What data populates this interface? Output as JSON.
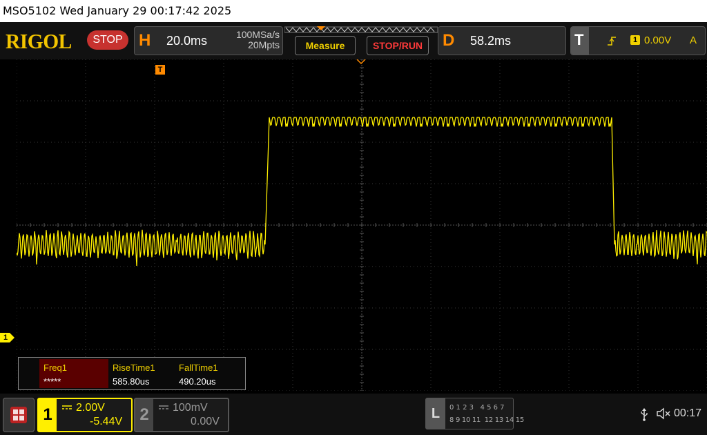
{
  "title": "MSO5102  Wed January 29 00:17:42 2025",
  "brand": "RIGOL",
  "run_state": "STOP",
  "horizontal": {
    "letter": "H",
    "timebase": "20.0ms",
    "sample_rate": "100MSa/s",
    "memory_depth": "20Mpts"
  },
  "buttons": {
    "measure": "Measure",
    "stop_run": "STOP/RUN"
  },
  "delay": {
    "letter": "D",
    "value": "58.2ms"
  },
  "trigger": {
    "letter": "T",
    "channel": "1",
    "level": "0.00V",
    "mode": "A"
  },
  "markers": {
    "trigger_position": "T",
    "ch1_ground": "1"
  },
  "measurements": [
    {
      "label": "Freq1",
      "value": "*****"
    },
    {
      "label": "RiseTime1",
      "value": "585.80us"
    },
    {
      "label": "FallTime1",
      "value": "490.20us"
    }
  ],
  "channels": [
    {
      "number": "1",
      "scale": "2.00V",
      "offset": "-5.44V",
      "color": "#ffef00"
    },
    {
      "number": "2",
      "scale": "100mV",
      "offset": "0.00V",
      "color": "#888888"
    }
  ],
  "logic": {
    "letter": "L",
    "row1": "0 1 2 3   4 5 6 7",
    "row2": "8 9 10 11  12 13 14 15"
  },
  "status": {
    "time": "00:17"
  },
  "colors": {
    "trace": "#ffef00",
    "accent": "#ff8a00",
    "stop": "#c7322f",
    "brand": "#f2c400"
  }
}
